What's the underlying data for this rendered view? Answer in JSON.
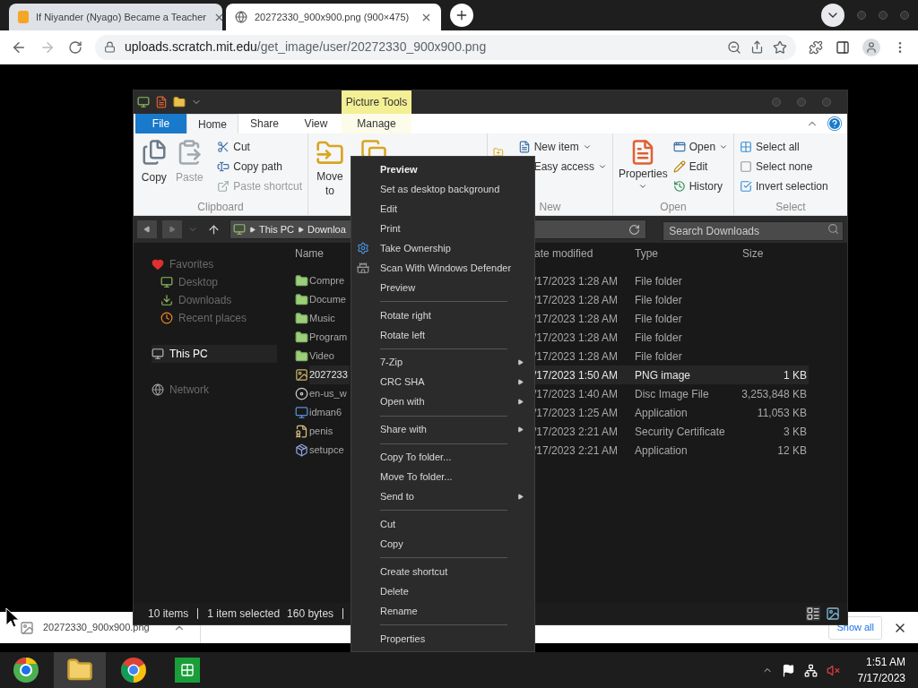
{
  "browser": {
    "tabs": [
      {
        "title": "If Niyander (Nyago) Became a Teacher",
        "selected": false
      },
      {
        "title": "20272330_900x900.png (900×475)",
        "selected": true
      }
    ],
    "address": {
      "host": "uploads.scratch.mit.edu",
      "path": "/get_image/user/20272330_900x900.png"
    }
  },
  "explorer": {
    "contextual_tab": "Picture Tools",
    "ribbon_tabs": [
      {
        "label": "File",
        "kind": "file",
        "selected": false
      },
      {
        "label": "Home",
        "kind": "tab",
        "selected": true
      },
      {
        "label": "Share",
        "kind": "tab",
        "selected": false
      },
      {
        "label": "View",
        "kind": "tab",
        "selected": false
      },
      {
        "label": "Manage",
        "kind": "contextual",
        "selected": false
      }
    ],
    "clipboard": {
      "label": "Clipboard",
      "large": [
        {
          "label": "Copy",
          "disabled": false
        },
        {
          "label": "Paste",
          "disabled": true
        }
      ],
      "small": [
        {
          "label": "Cut",
          "disabled": false
        },
        {
          "label": "Copy path",
          "disabled": false
        },
        {
          "label": "Paste shortcut",
          "disabled": true
        }
      ]
    },
    "organize": {
      "move_to": "Move to"
    },
    "new": {
      "label": "New",
      "small": [
        {
          "label": "New item",
          "dropdown": true
        },
        {
          "label": "Easy access",
          "dropdown": true
        }
      ]
    },
    "open": {
      "label": "Open",
      "large": {
        "label": "Properties",
        "dropdown": true
      },
      "small": [
        {
          "label": "Open",
          "dropdown": true
        },
        {
          "label": "Edit",
          "dropdown": false
        },
        {
          "label": "History",
          "dropdown": false
        }
      ]
    },
    "select": {
      "label": "Select",
      "small": [
        {
          "label": "Select all"
        },
        {
          "label": "Select none"
        },
        {
          "label": "Invert selection"
        }
      ]
    },
    "path": [
      "This PC",
      "Downloa"
    ],
    "search": {
      "placeholder": "Search Downloads"
    },
    "nav": [
      {
        "label": "Favorites",
        "selected": false,
        "children": [
          {
            "label": "Desktop",
            "selected": false
          },
          {
            "label": "Downloads",
            "selected": false
          },
          {
            "label": "Recent places",
            "selected": false
          }
        ]
      },
      {
        "label": "This PC",
        "selected": true
      },
      {
        "label": "Network",
        "selected": false
      }
    ],
    "columns": [
      "Name",
      "ate modified",
      "Type",
      "Size"
    ],
    "rows": [
      {
        "kind": "folder",
        "name": "Compre",
        "date": "/17/2023 1:28 AM",
        "type": "File folder",
        "size": "",
        "selected": false
      },
      {
        "kind": "folder",
        "name": "Docume",
        "date": "/17/2023 1:28 AM",
        "type": "File folder",
        "selected": false
      },
      {
        "kind": "folder",
        "name": "Music",
        "date": "/17/2023 1:28 AM",
        "type": "File folder",
        "selected": false
      },
      {
        "kind": "folder",
        "name": "Program",
        "date": "/17/2023 1:28 AM",
        "type": "File folder",
        "selected": false
      },
      {
        "kind": "folder",
        "name": "Video",
        "date": "/17/2023 1:28 AM",
        "type": "File folder",
        "selected": false
      },
      {
        "kind": "image",
        "name": "2027233",
        "date": "/17/2023 1:50 AM",
        "type": "PNG image",
        "size": "1 KB",
        "selected": true
      },
      {
        "kind": "disc",
        "name": "en-us_w",
        "date": "/17/2023 1:40 AM",
        "type": "Disc Image File",
        "size": "3,253,848 KB",
        "selected": false
      },
      {
        "kind": "application",
        "name": "idman6",
        "date": "/17/2023 1:25 AM",
        "type": "Application",
        "size": "11,053 KB",
        "selected": false
      },
      {
        "kind": "certificate",
        "name": "penis",
        "date": "/17/2023 2:21 AM",
        "type": "Security Certificate",
        "size": "3 KB",
        "selected": false
      },
      {
        "kind": "setup",
        "name": "setupce",
        "date": "/17/2023 2:21 AM",
        "type": "Application",
        "size": "12 KB",
        "selected": false
      }
    ],
    "status": {
      "count": "10 items",
      "selection": "1 item selected",
      "bytes": "160 bytes"
    }
  },
  "context_menu": [
    {
      "kind": "item",
      "label": "Preview",
      "default": true,
      "submenu": false
    },
    {
      "kind": "item",
      "label": "Set as desktop background",
      "default": false,
      "submenu": false
    },
    {
      "kind": "item",
      "label": "Edit",
      "default": false,
      "submenu": false
    },
    {
      "kind": "item",
      "label": "Print",
      "default": false,
      "submenu": false
    },
    {
      "kind": "item",
      "label": "Take Ownership",
      "default": false,
      "submenu": false
    },
    {
      "kind": "item",
      "label": "Scan With Windows Defender",
      "default": false,
      "submenu": false
    },
    {
      "kind": "item",
      "label": "Preview",
      "default": false,
      "submenu": false
    },
    {
      "kind": "separator"
    },
    {
      "kind": "item",
      "label": "Rotate right",
      "default": false,
      "submenu": false
    },
    {
      "kind": "item",
      "label": "Rotate left",
      "default": false,
      "submenu": false
    },
    {
      "kind": "separator"
    },
    {
      "kind": "item",
      "label": "7-Zip",
      "default": false,
      "submenu": true
    },
    {
      "kind": "item",
      "label": "CRC SHA",
      "default": false,
      "submenu": true
    },
    {
      "kind": "item",
      "label": "Open with",
      "default": false,
      "submenu": true
    },
    {
      "kind": "separator"
    },
    {
      "kind": "item",
      "label": "Share with",
      "default": false,
      "submenu": true
    },
    {
      "kind": "separator"
    },
    {
      "kind": "item",
      "label": "Copy To folder...",
      "default": false,
      "submenu": false
    },
    {
      "kind": "item",
      "label": "Move To folder...",
      "default": false,
      "submenu": false
    },
    {
      "kind": "item",
      "label": "Send to",
      "default": false,
      "submenu": true
    },
    {
      "kind": "separator"
    },
    {
      "kind": "item",
      "label": "Cut",
      "default": false,
      "submenu": false
    },
    {
      "kind": "item",
      "label": "Copy",
      "default": false,
      "submenu": false
    },
    {
      "kind": "separator"
    },
    {
      "kind": "item",
      "label": "Create shortcut",
      "default": false,
      "submenu": false
    },
    {
      "kind": "item",
      "label": "Delete",
      "default": false,
      "submenu": false
    },
    {
      "kind": "item",
      "label": "Rename",
      "default": false,
      "submenu": false
    },
    {
      "kind": "separator"
    },
    {
      "kind": "item",
      "label": "Properties",
      "default": false,
      "submenu": false
    }
  ],
  "download_bar": {
    "file": "20272330_900x900.png",
    "show_all": "Show all"
  },
  "taskbar": {
    "apps": [
      {
        "selected": false
      },
      {
        "selected": true
      },
      {
        "selected": false
      },
      {
        "selected": false
      }
    ],
    "time": "1:51 AM",
    "date": "7/17/2023"
  }
}
